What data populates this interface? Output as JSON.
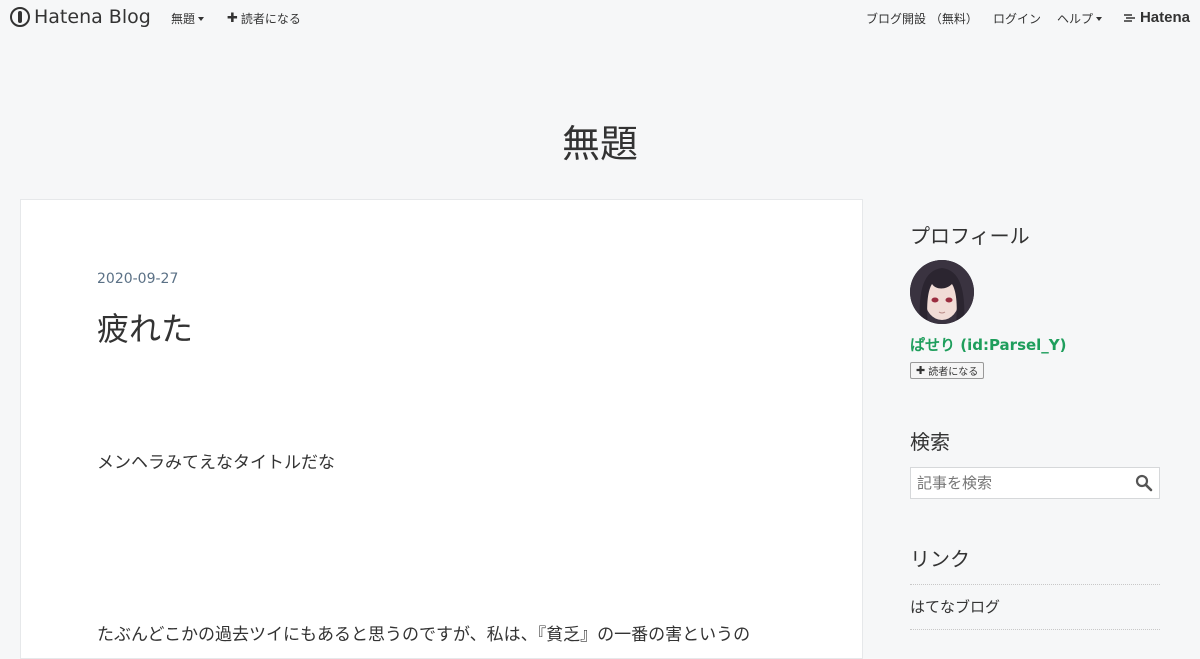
{
  "header": {
    "logo_text": "Hatena Blog",
    "nav_left": [
      {
        "label": "無題",
        "has_caret": true
      },
      {
        "label": "読者になる",
        "icon": "plus-icon"
      }
    ],
    "nav_right": [
      {
        "label": "ブログ開設 （無料）"
      },
      {
        "label": "ログイン"
      },
      {
        "label": "ヘルプ",
        "has_caret": true
      }
    ],
    "brand_text": "Hatena"
  },
  "blog": {
    "title": "無題"
  },
  "article": {
    "date": "2020-09-27",
    "title": "疲れた",
    "paragraphs": [
      "メンヘラみてえなタイトルだな",
      "たぶんどこかの過去ツイにもあると思うのですが、私は、『貧乏』の一番の害というの"
    ]
  },
  "sidebar": {
    "profile": {
      "heading": "プロフィール",
      "name": "ぱせり (id:Parsel_Y)",
      "subscribe_label": "読者になる"
    },
    "search": {
      "heading": "検索",
      "placeholder": "記事を検索"
    },
    "links": {
      "heading": "リンク",
      "items": [
        "はてなブログ"
      ]
    }
  },
  "colors": {
    "page_bg": "#f6f7f8",
    "card_bg": "#ffffff",
    "profile_name": "#1e9e5c",
    "date_text": "#5b7186"
  }
}
